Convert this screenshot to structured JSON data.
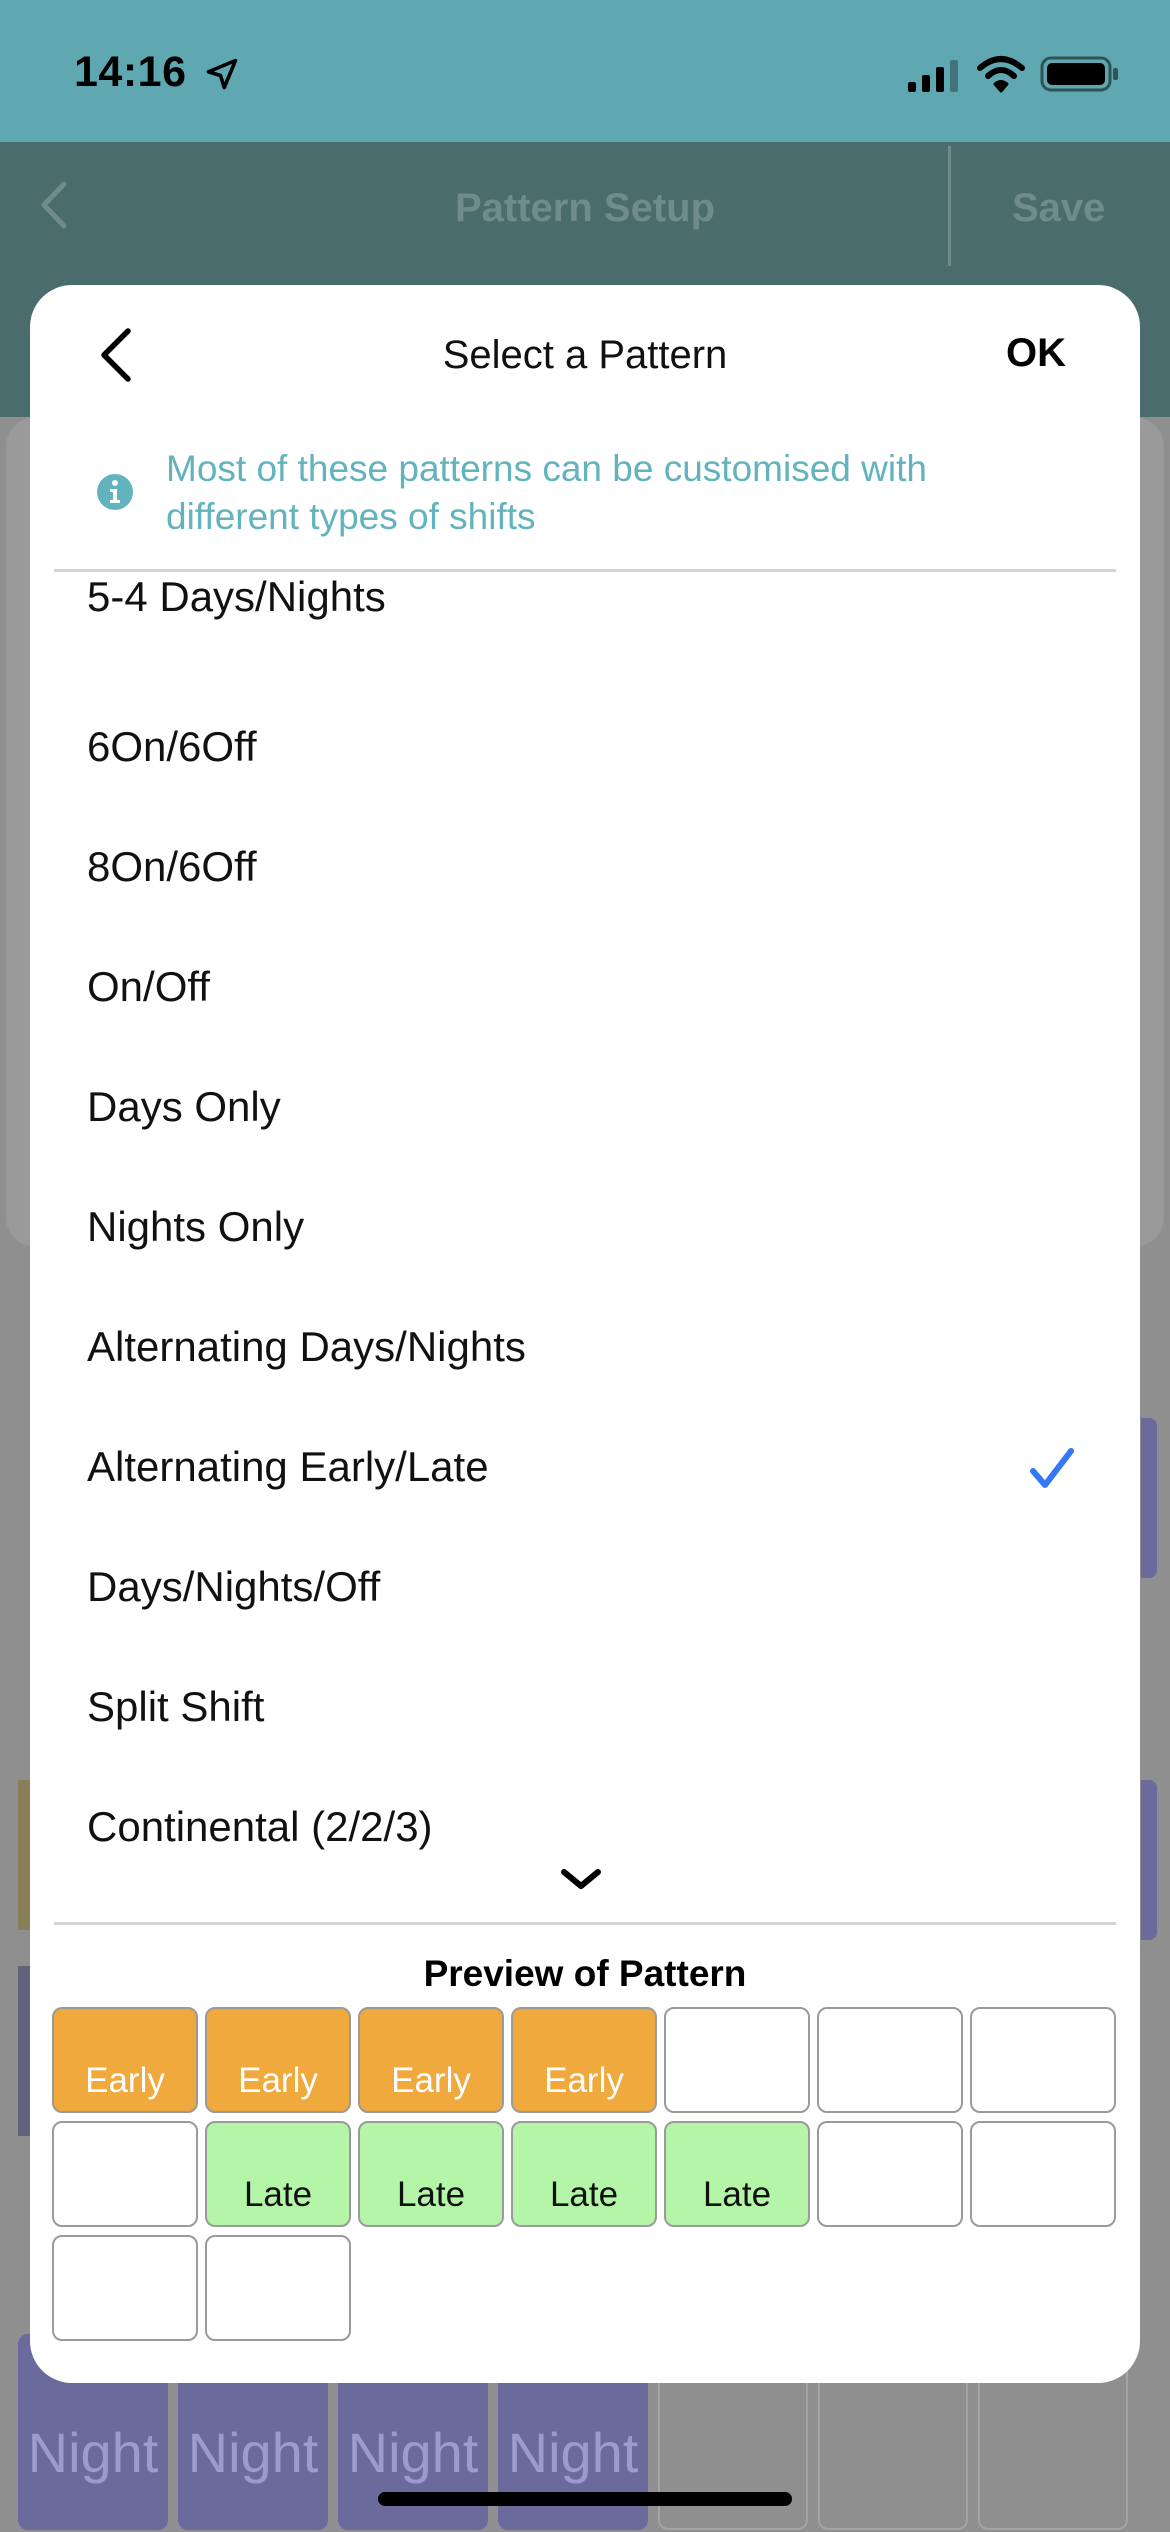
{
  "status_bar": {
    "time": "14:16"
  },
  "background_screen": {
    "title": "Pattern Setup",
    "save_label": "Save",
    "night_cells": [
      "Night",
      "Night",
      "Night",
      "Night"
    ]
  },
  "modal": {
    "title": "Select a Pattern",
    "ok_label": "OK",
    "info_text": "Most of these patterns can be customised with different types of shifts",
    "patterns": [
      {
        "label": "5-4 Days/Nights",
        "selected": false
      },
      {
        "label": "6On/6Off",
        "selected": false
      },
      {
        "label": "8On/6Off",
        "selected": false
      },
      {
        "label": "On/Off",
        "selected": false
      },
      {
        "label": "Days Only",
        "selected": false
      },
      {
        "label": "Nights Only",
        "selected": false
      },
      {
        "label": "Alternating Days/Nights",
        "selected": false
      },
      {
        "label": "Alternating Early/Late",
        "selected": true
      },
      {
        "label": "Days/Nights/Off",
        "selected": false
      },
      {
        "label": "Split Shift",
        "selected": false
      },
      {
        "label": "Continental (2/2/3)",
        "selected": false
      }
    ],
    "preview": {
      "title": "Preview of Pattern",
      "cells": [
        {
          "label": "Early",
          "type": "early"
        },
        {
          "label": "Early",
          "type": "early"
        },
        {
          "label": "Early",
          "type": "early"
        },
        {
          "label": "Early",
          "type": "early"
        },
        {
          "label": "",
          "type": "off"
        },
        {
          "label": "",
          "type": "off"
        },
        {
          "label": "",
          "type": "off"
        },
        {
          "label": "",
          "type": "off"
        },
        {
          "label": "Late",
          "type": "late"
        },
        {
          "label": "Late",
          "type": "late"
        },
        {
          "label": "Late",
          "type": "late"
        },
        {
          "label": "Late",
          "type": "late"
        },
        {
          "label": "",
          "type": "off"
        },
        {
          "label": "",
          "type": "off"
        },
        {
          "label": "",
          "type": "off"
        },
        {
          "label": "",
          "type": "off"
        }
      ]
    }
  },
  "colors": {
    "teal_header": "#5fa8b1",
    "early": "#f0a93c",
    "late": "#b5f5a8",
    "night": "#6a6a9c",
    "check": "#3478f6",
    "info_text": "#62b3bd"
  }
}
